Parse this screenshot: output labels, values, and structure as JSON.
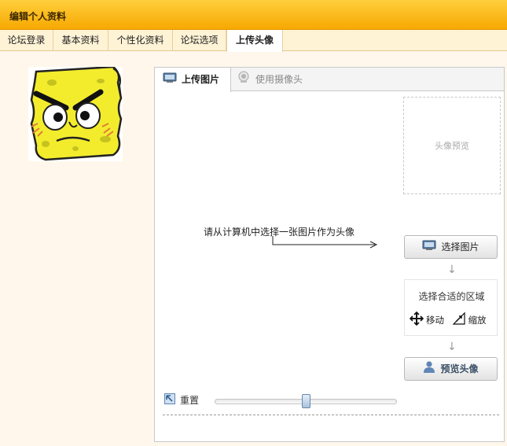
{
  "window": {
    "title": "编辑个人资料"
  },
  "tabs": [
    {
      "label": "论坛登录",
      "active": false
    },
    {
      "label": "基本资料",
      "active": false
    },
    {
      "label": "个性化资料",
      "active": false
    },
    {
      "label": "论坛选项",
      "active": false
    },
    {
      "label": "上传头像",
      "active": true
    }
  ],
  "avatar": {
    "icon": "spongebob-angry-avatar"
  },
  "upload_panel": {
    "tabs": [
      {
        "label": "上传图片",
        "active": true,
        "icon": "monitor-icon"
      },
      {
        "label": "使用摄像头",
        "active": false,
        "icon": "webcam-icon"
      }
    ],
    "preview_label": "头像预览",
    "hint": "请从计算机中选择一张图片作为头像",
    "select_button": "选择图片",
    "area": {
      "title": "选择合适的区域",
      "move_label": "移动",
      "zoom_label": "缩放"
    },
    "preview_button": "预览头像",
    "reset_label": "重置",
    "zoom_slider": {
      "value": 0.5
    }
  },
  "colors": {
    "title_bar": "#f7b400",
    "page_background": "#fff7ec",
    "tab_bar": "#fff3d6"
  }
}
